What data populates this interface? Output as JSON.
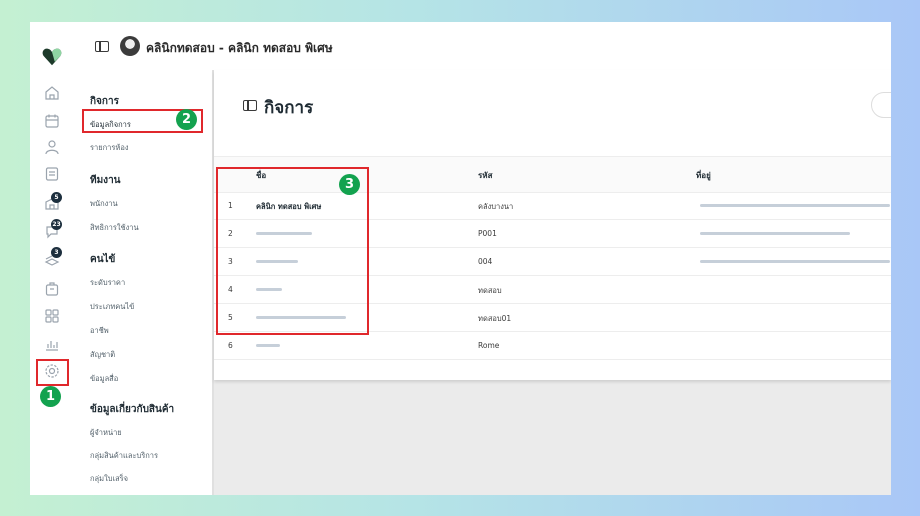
{
  "header": {
    "title": "คลินิกทดสอบ - คลินิก ทดสอบ พิเศษ"
  },
  "rail": {
    "icons": [
      "home-icon",
      "calendar-icon",
      "user-icon",
      "form-icon",
      "building-icon",
      "chat-icon",
      "stack-icon",
      "box-icon",
      "grid-icon",
      "chart-icon",
      "settings-icon"
    ],
    "badges": [
      "5",
      "23",
      "3"
    ]
  },
  "sidebar": {
    "sections": [
      {
        "title": "กิจการ",
        "items": [
          "ข้อมูลกิจการ",
          "รายการห้อง"
        ]
      },
      {
        "title": "ทีมงาน",
        "items": [
          "พนักงาน",
          "สิทธิการใช้งาน"
        ]
      },
      {
        "title": "คนไข้",
        "items": [
          "ระดับราคา",
          "ประเภทคนไข้",
          "อาชีพ",
          "สัญชาติ",
          "ข้อมูลสื่อ"
        ]
      },
      {
        "title": "ข้อมูลเกี่ยวกับสินค้า",
        "items": [
          "ผู้จำหน่าย",
          "กลุ่มสินค้าและบริการ",
          "กลุ่มใบเสร็จ"
        ]
      }
    ]
  },
  "main": {
    "heading": "กิจการ",
    "columns": [
      "ชื่อ",
      "รหัส",
      "ที่อยู่"
    ],
    "rows": [
      {
        "index": "1",
        "name": "คลินิก ทดสอบ พิเศษ",
        "code": "คลังบางนา"
      },
      {
        "index": "2",
        "name": "",
        "code": "P001"
      },
      {
        "index": "3",
        "name": "",
        "code": "004"
      },
      {
        "index": "4",
        "name": "",
        "code": "ทดสอบ"
      },
      {
        "index": "5",
        "name": "",
        "code": "ทดสอบ01"
      },
      {
        "index": "6",
        "name": "",
        "code": "Rome"
      }
    ]
  },
  "annotations": [
    "1",
    "2",
    "3"
  ],
  "colors": {
    "highlight": "#e0282c",
    "step_badge": "#13a24f",
    "brand": "#1d3a2a"
  }
}
